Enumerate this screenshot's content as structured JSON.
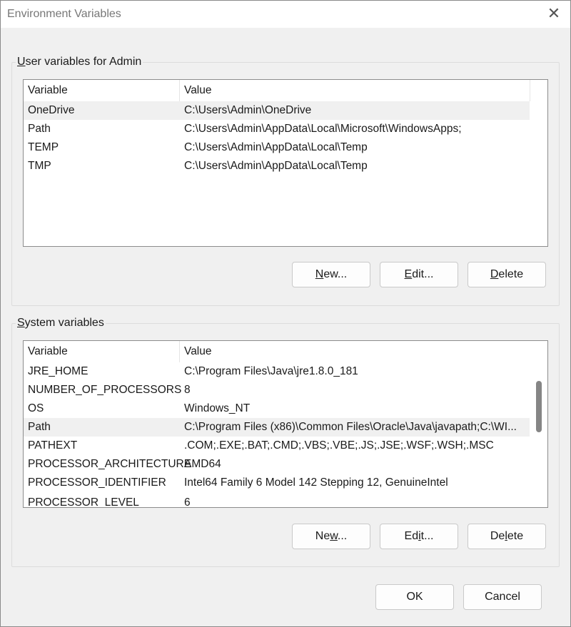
{
  "window": {
    "title": "Environment Variables",
    "close_glyph": "✕"
  },
  "user_vars": {
    "label_prefix": "",
    "label_mnemonic": "U",
    "label_rest": "ser variables for Admin",
    "col_variable": "Variable",
    "col_value": "Value",
    "rows": [
      {
        "variable": "OneDrive",
        "value": "C:\\Users\\Admin\\OneDrive"
      },
      {
        "variable": "Path",
        "value": "C:\\Users\\Admin\\AppData\\Local\\Microsoft\\WindowsApps;"
      },
      {
        "variable": "TEMP",
        "value": "C:\\Users\\Admin\\AppData\\Local\\Temp"
      },
      {
        "variable": "TMP",
        "value": "C:\\Users\\Admin\\AppData\\Local\\Temp"
      }
    ],
    "buttons": {
      "new_mnemonic": "N",
      "new_rest": "ew...",
      "edit_mnemonic": "E",
      "edit_rest": "dit...",
      "delete_mnemonic": "D",
      "delete_rest": "elete"
    }
  },
  "system_vars": {
    "label_mnemonic": "S",
    "label_rest": "ystem variables",
    "col_variable": "Variable",
    "col_value": "Value",
    "rows": [
      {
        "variable": "JRE_HOME",
        "value": "C:\\Program Files\\Java\\jre1.8.0_181"
      },
      {
        "variable": "NUMBER_OF_PROCESSORS",
        "value": "8"
      },
      {
        "variable": "OS",
        "value": "Windows_NT"
      },
      {
        "variable": "Path",
        "value": "C:\\Program Files (x86)\\Common Files\\Oracle\\Java\\javapath;C:\\WI..."
      },
      {
        "variable": "PATHEXT",
        "value": ".COM;.EXE;.BAT;.CMD;.VBS;.VBE;.JS;.JSE;.WSF;.WSH;.MSC"
      },
      {
        "variable": "PROCESSOR_ARCHITECTURE",
        "value": "AMD64"
      },
      {
        "variable": "PROCESSOR_IDENTIFIER",
        "value": "Intel64 Family 6 Model 142 Stepping 12, GenuineIntel"
      },
      {
        "variable": "PROCESSOR_LEVEL",
        "value": "6"
      }
    ],
    "buttons": {
      "new_pre": "Ne",
      "new_mnemonic": "w",
      "new_rest": "...",
      "edit_pre": "Ed",
      "edit_mnemonic": "i",
      "edit_rest": "t...",
      "delete_pre": "De",
      "delete_mnemonic": "l",
      "delete_rest": "ete"
    }
  },
  "footer": {
    "ok_label": "OK",
    "cancel_label": "Cancel"
  }
}
